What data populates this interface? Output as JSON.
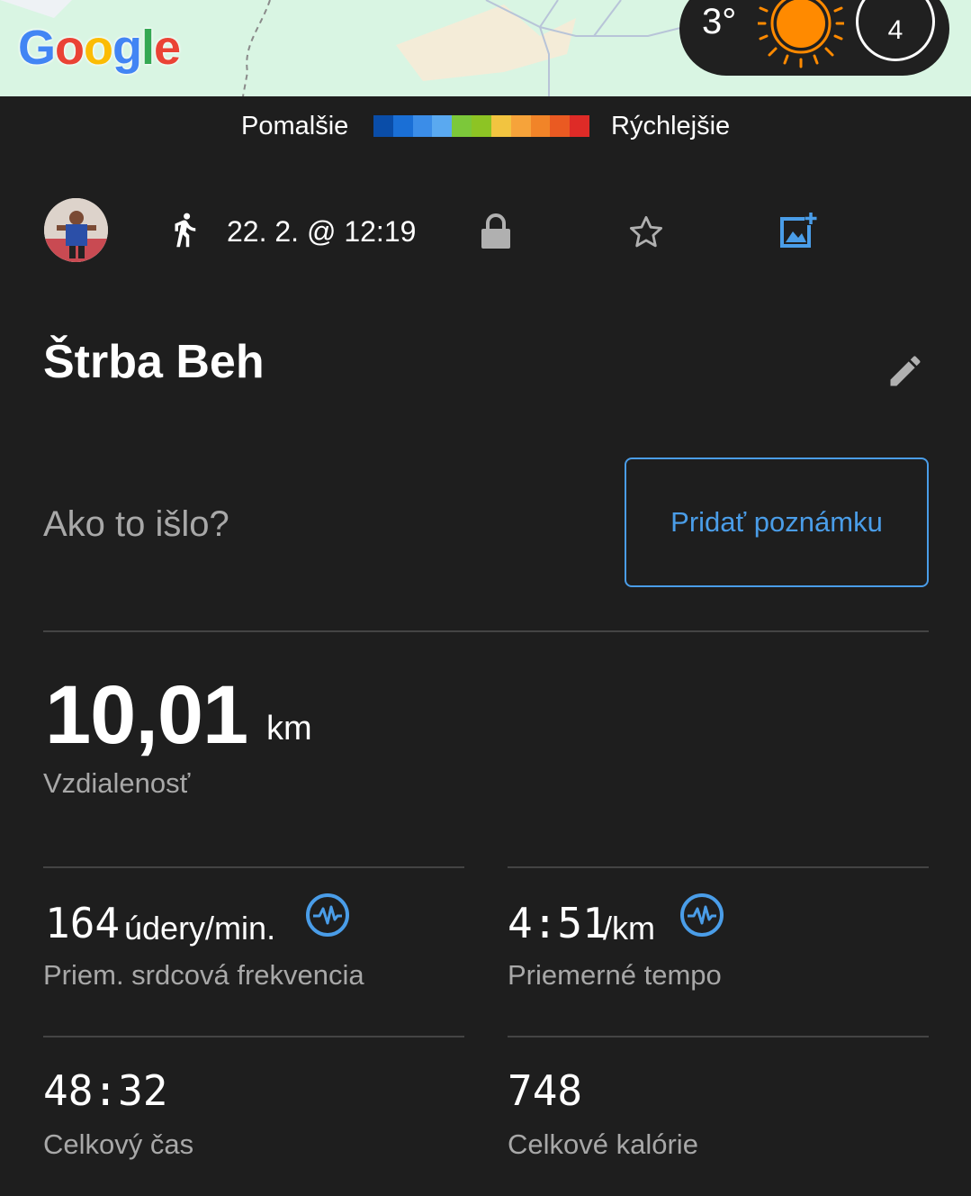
{
  "map": {
    "logo": "Google",
    "weather": {
      "temperature": "3°",
      "icon": "sun-icon",
      "badge": "4"
    }
  },
  "legend": {
    "slow_label": "Pomalšie",
    "fast_label": "Rýchlejšie",
    "colors": [
      "#0a4da8",
      "#1a6fd6",
      "#3b8de8",
      "#5aa9f0",
      "#7cc83a",
      "#8dc424",
      "#f2c440",
      "#f6a33a",
      "#f18428",
      "#ea5a22",
      "#de2b27"
    ]
  },
  "activity": {
    "type_icon": "running-icon",
    "date": "22. 2. @ 12:19",
    "title": "Štrba Beh",
    "prompt": "Ako to išlo?",
    "add_note_label": "Pridať poznámku"
  },
  "stats": {
    "distance": {
      "value": "10,01",
      "unit": "km",
      "label": "Vzdialenosť"
    },
    "heart_rate": {
      "value": "164",
      "unit": "údery/min.",
      "label": "Priem. srdcová frekvencia"
    },
    "pace": {
      "value": "4:51",
      "unit": "/km",
      "label": "Priemerné tempo"
    },
    "time": {
      "value": "48:32",
      "label": "Celkový čas"
    },
    "calories": {
      "value": "748",
      "label": "Celkové kalórie"
    }
  },
  "colors": {
    "background": "#1e1e1e",
    "accent": "#4a9de8",
    "muted_text": "#a8a8a8",
    "map_bg": "#d9f5e3"
  }
}
